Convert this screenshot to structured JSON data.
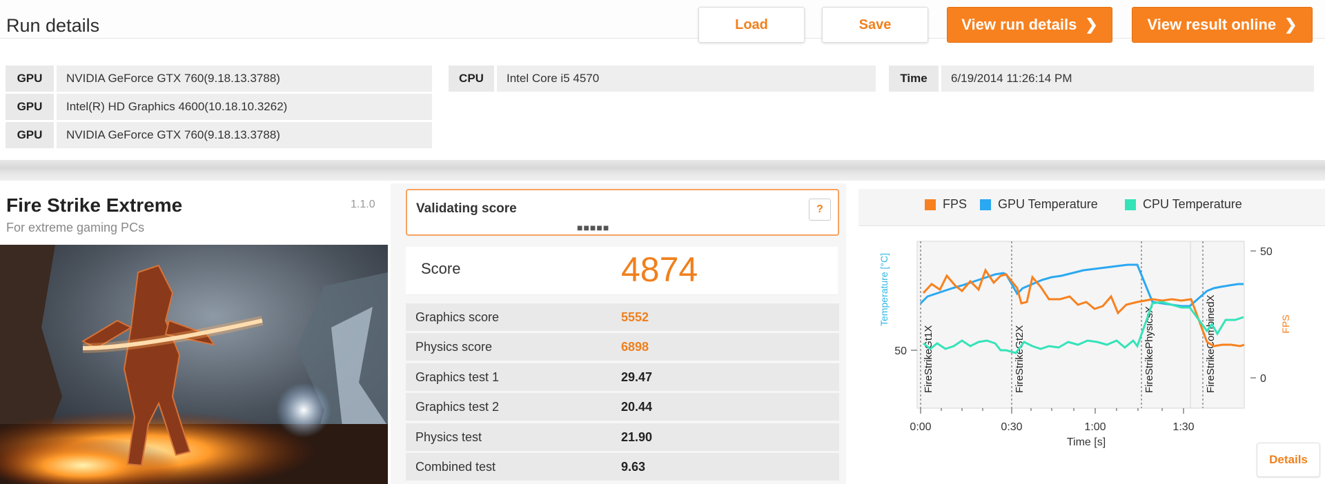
{
  "header": {
    "title": "Run details",
    "load_label": "Load",
    "save_label": "Save",
    "view_run_details_label": "View run details",
    "view_result_online_label": "View result online"
  },
  "system": {
    "gpus": [
      {
        "label": "GPU",
        "value": "NVIDIA GeForce GTX 760(9.18.13.3788)"
      },
      {
        "label": "GPU",
        "value": "Intel(R) HD Graphics 4600(10.18.10.3262)"
      },
      {
        "label": "GPU",
        "value": "NVIDIA GeForce GTX 760(9.18.13.3788)"
      }
    ],
    "cpu": {
      "label": "CPU",
      "value": "Intel Core i5 4570"
    },
    "time": {
      "label": "Time",
      "value": "6/19/2014 11:26:14 PM"
    }
  },
  "benchmark": {
    "name": "Fire Strike Extreme",
    "version": "1.1.0",
    "subtitle": "For extreme gaming PCs"
  },
  "validation": {
    "title": "Validating score",
    "dots": "■■■■■",
    "help": "?"
  },
  "score": {
    "label": "Score",
    "value": "4874"
  },
  "subscores": [
    {
      "label": "Graphics score",
      "value": "5552",
      "highlight": true
    },
    {
      "label": "Physics score",
      "value": "6898",
      "highlight": true
    },
    {
      "label": "Graphics test 1",
      "value": "29.47",
      "highlight": false
    },
    {
      "label": "Graphics test 2",
      "value": "20.44",
      "highlight": false
    },
    {
      "label": "Physics test",
      "value": "21.90",
      "highlight": false
    },
    {
      "label": "Combined test",
      "value": "9.63",
      "highlight": false
    }
  ],
  "monitor": {
    "legend": [
      {
        "name": "FPS",
        "color": "#f7811f"
      },
      {
        "name": "GPU Temperature",
        "color": "#2aa8f2"
      },
      {
        "name": "CPU Temperature",
        "color": "#35e3b9"
      }
    ],
    "y_left_label": "Temperature [°C]",
    "y_left_tick": "50",
    "y_right_label": "FPS",
    "y_right_ticks": [
      "50",
      "0"
    ],
    "x_label": "Time [s]",
    "x_ticks": [
      "0:00",
      "0:30",
      "1:00",
      "1:30"
    ],
    "segments": [
      "FireStrikeGt1X",
      "FireStrikeGt2X",
      "FireStrikePhysicsX",
      "FireStrikeCombinedX"
    ],
    "details_label": "Details"
  },
  "colors": {
    "accent": "#f7811f"
  }
}
